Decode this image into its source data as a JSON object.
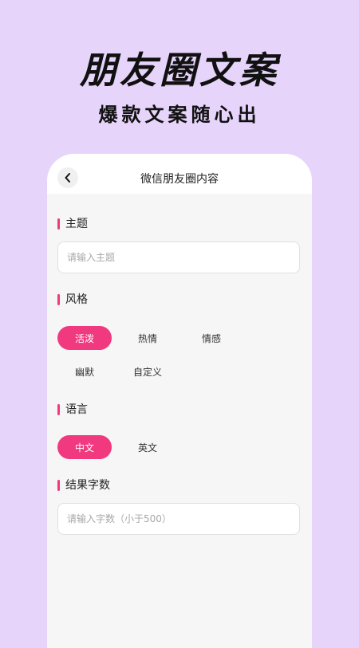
{
  "promo": {
    "title": "朋友圈文案",
    "subtitle": "爆款文案随心出"
  },
  "nav": {
    "back_icon": "chevron-left-icon",
    "title": "微信朋友圈内容"
  },
  "form": {
    "topic": {
      "label": "主题",
      "placeholder": "请输入主题",
      "value": ""
    },
    "style": {
      "label": "风格",
      "options": [
        "活泼",
        "热情",
        "情感",
        "幽默",
        "自定义"
      ],
      "selected": "活泼"
    },
    "language": {
      "label": "语言",
      "options": [
        "中文",
        "英文"
      ],
      "selected": "中文"
    },
    "word_count": {
      "label": "结果字数",
      "placeholder": "请输入字数（小于500）",
      "value": ""
    }
  },
  "colors": {
    "background": "#e7d4fb",
    "accent": "#f0397f",
    "card": "#f6f6f6"
  }
}
